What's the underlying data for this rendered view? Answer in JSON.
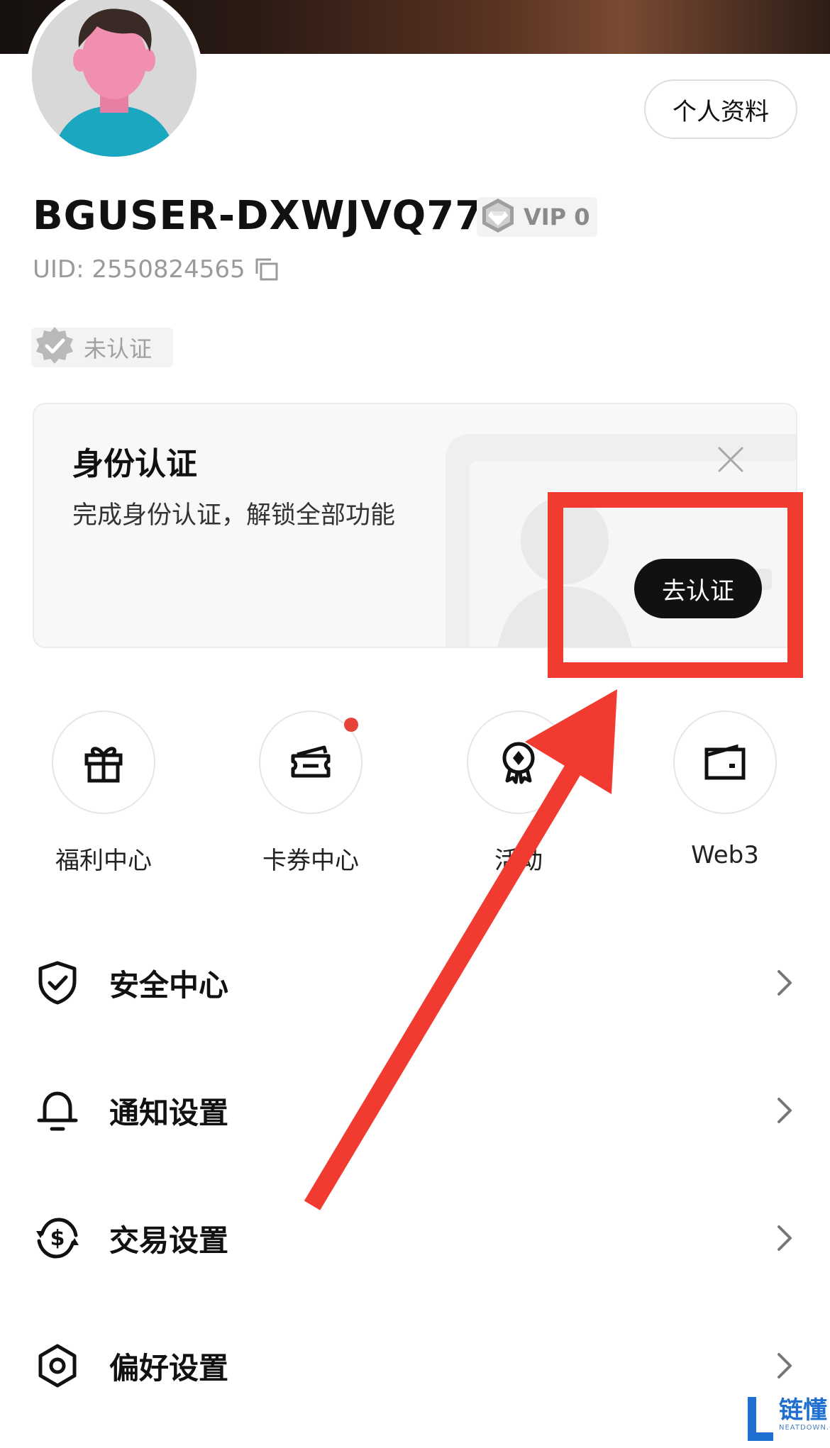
{
  "profile": {
    "button_label": "个人资料",
    "username": "BGUSER-DXWJVQ77",
    "vip": "VIP 0",
    "uid": "UID: 2550824565",
    "verification_status": "未认证"
  },
  "verify_card": {
    "title": "身份认证",
    "subtitle": "完成身份认证，解锁全部功能",
    "button": "去认证"
  },
  "quick_actions": [
    {
      "label": "福利中心",
      "icon": "gift-icon"
    },
    {
      "label": "卡券中心",
      "icon": "coupon-icon",
      "badge": true
    },
    {
      "label": "活动",
      "icon": "award-icon"
    },
    {
      "label": "Web3",
      "icon": "wallet-icon"
    }
  ],
  "menu": [
    {
      "label": "安全中心",
      "icon": "shield-check-icon"
    },
    {
      "label": "通知设置",
      "icon": "bell-icon"
    },
    {
      "label": "交易设置",
      "icon": "dollar-cycle-icon"
    },
    {
      "label": "偏好设置",
      "icon": "hexagon-settings-icon"
    }
  ],
  "watermark": {
    "main": "链懂",
    "sub": "NEATDOWN.COM"
  },
  "colors": {
    "highlight": "#f23b30",
    "avatar_shirt": "#1aa7bf",
    "avatar_skin": "#f08fb0",
    "badge_dot": "#e8433a",
    "watermark_blue": "#1f6fd0"
  }
}
